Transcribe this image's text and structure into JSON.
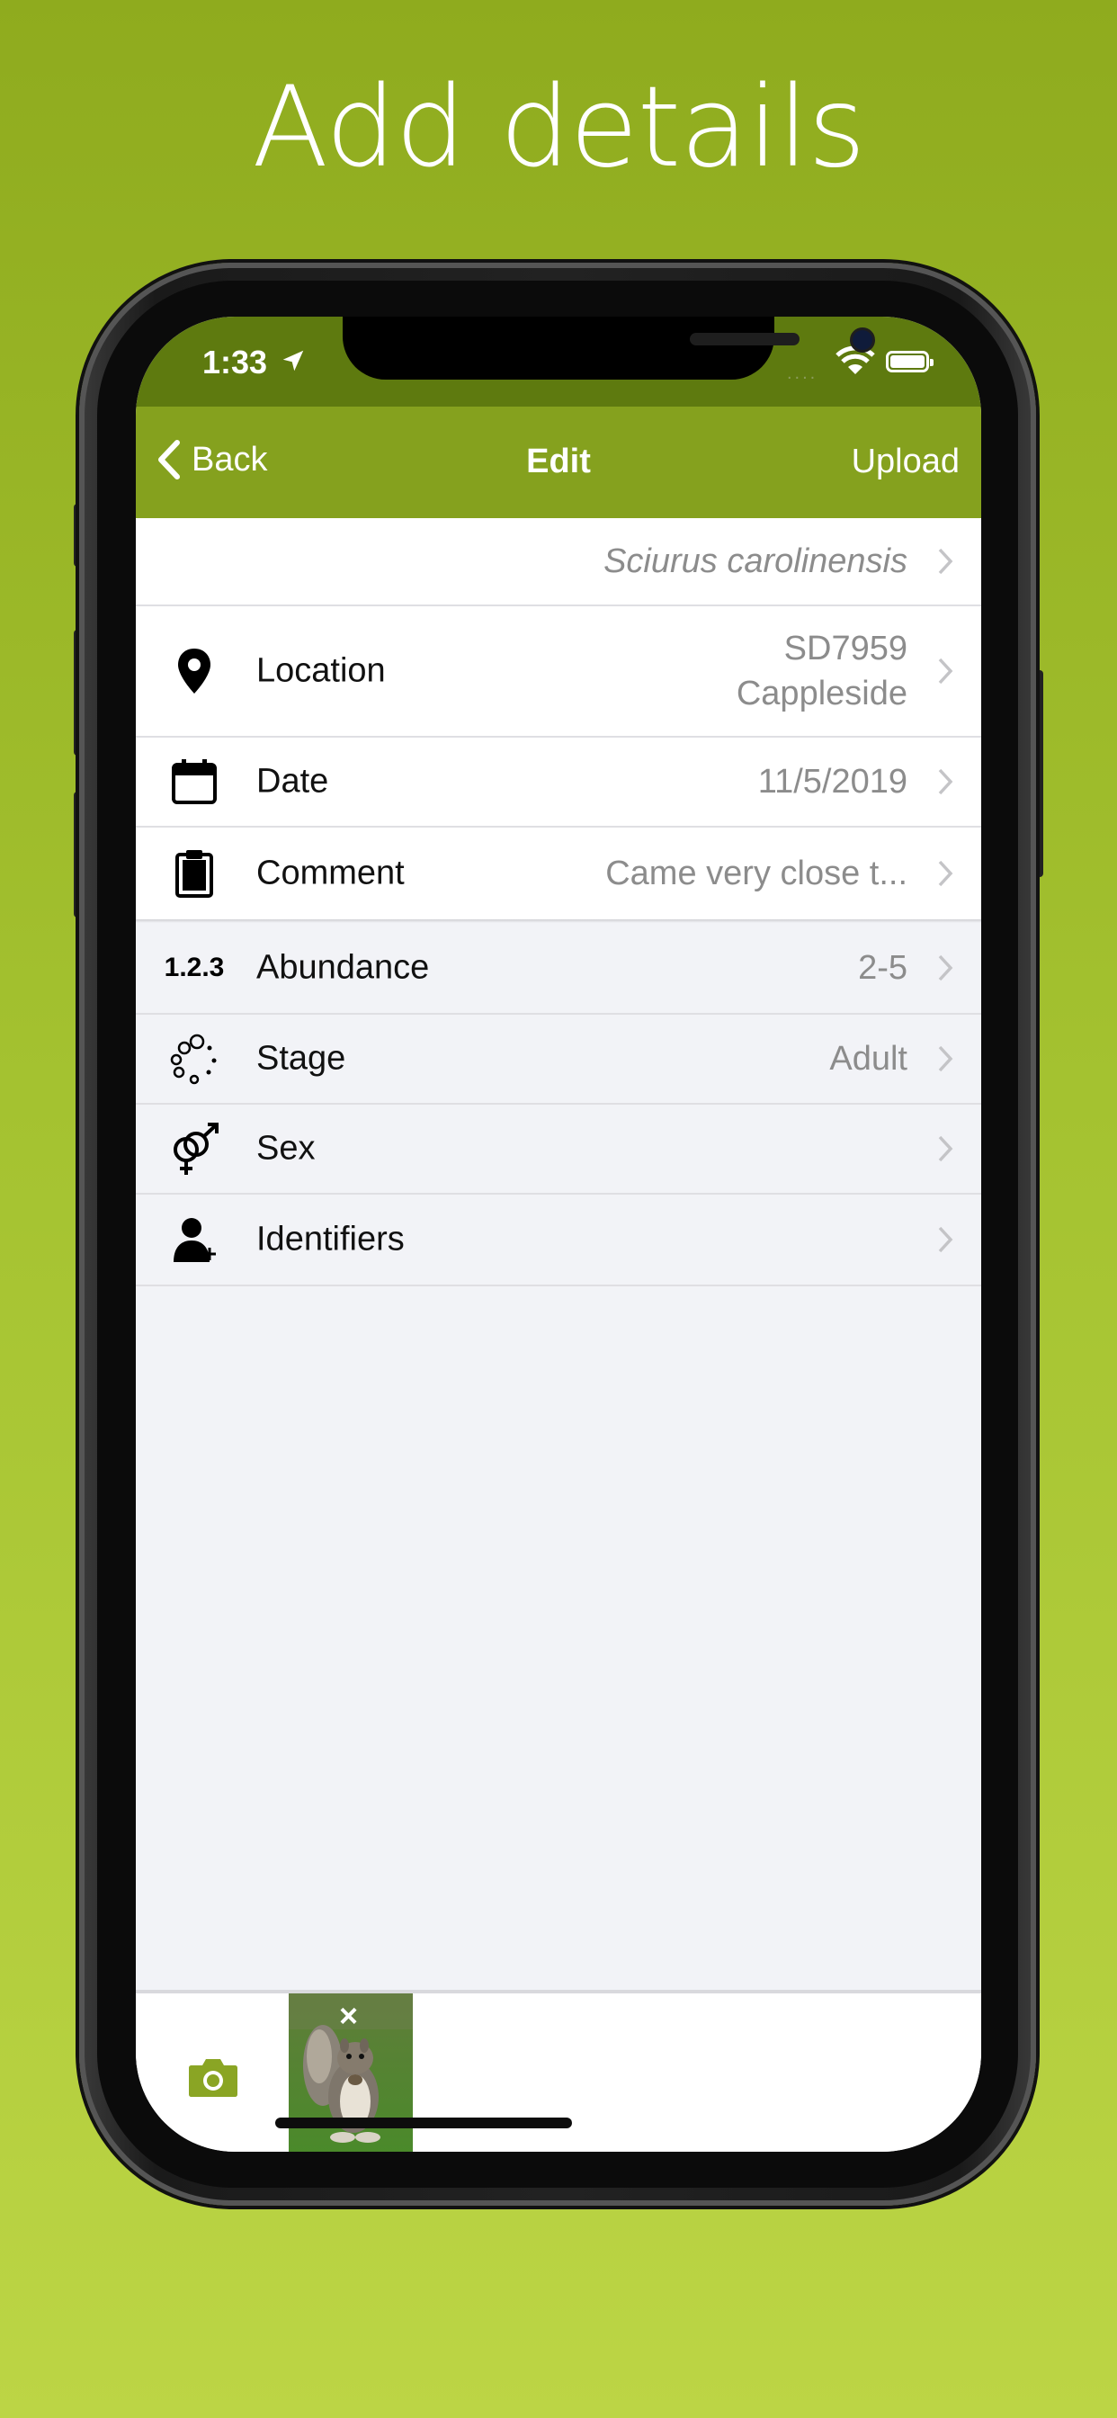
{
  "headline": "Add details",
  "status": {
    "time": "1:33",
    "signal": "....",
    "icons": [
      "location-arrow-icon",
      "wifi-icon",
      "battery-icon"
    ]
  },
  "navbar": {
    "back_label": "Back",
    "title": "Edit",
    "upload_label": "Upload"
  },
  "rows": [
    {
      "name": "species",
      "label": "",
      "value": "Sciurus carolinensis",
      "icon": ""
    },
    {
      "name": "location",
      "label": "Location",
      "value_line1": "SD7959",
      "value_line2": "Cappleside",
      "icon": "map-pin-icon"
    },
    {
      "name": "date",
      "label": "Date",
      "value": "11/5/2019",
      "icon": "calendar-icon"
    },
    {
      "name": "comment",
      "label": "Comment",
      "value": "Came very close t...",
      "icon": "clipboard-icon"
    },
    {
      "name": "abundance",
      "label": "Abundance",
      "value": "2-5",
      "icon": "numbers-icon",
      "icon_text": "1.2.3"
    },
    {
      "name": "stage",
      "label": "Stage",
      "value": "Adult",
      "icon": "stage-dots-icon"
    },
    {
      "name": "sex",
      "label": "Sex",
      "value": "",
      "icon": "gender-icon"
    },
    {
      "name": "identifiers",
      "label": "Identifiers",
      "value": "",
      "icon": "person-add-icon"
    }
  ],
  "bottombar": {
    "camera_icon": "camera-icon",
    "photo_close": "×"
  },
  "colors": {
    "nav": "#85a11e",
    "status": "#5e7a0f",
    "accent": "#8aa524"
  }
}
